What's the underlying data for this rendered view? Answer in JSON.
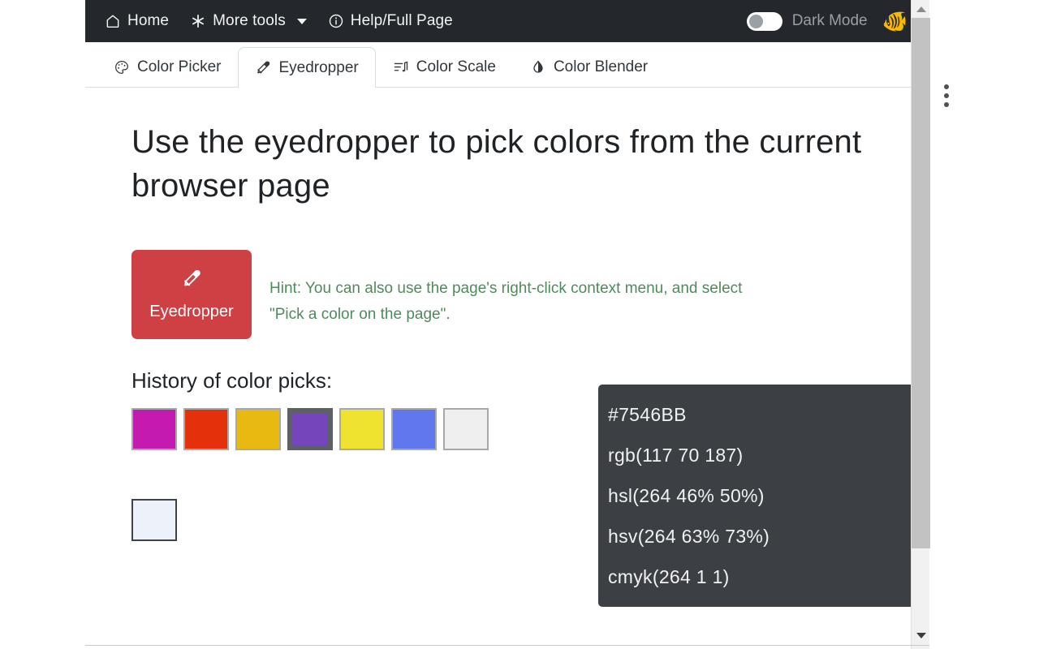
{
  "navbar": {
    "items": [
      {
        "label": "Home",
        "icon": "home-icon"
      },
      {
        "label": "More tools",
        "icon": "asterisk-icon",
        "has_caret": true
      },
      {
        "label": "Help/Full Page",
        "icon": "info-circle-icon"
      }
    ],
    "dark_mode": {
      "label": "Dark Mode",
      "enabled": false
    },
    "brand_emoji": "🐠"
  },
  "tabs": [
    {
      "label": "Color Picker",
      "icon": "palette-icon",
      "active": false
    },
    {
      "label": "Eyedropper",
      "icon": "eyedropper-icon",
      "active": true
    },
    {
      "label": "Color Scale",
      "icon": "scale-list-icon",
      "active": false
    },
    {
      "label": "Color Blender",
      "icon": "droplet-icon",
      "active": false
    }
  ],
  "main": {
    "title": "Use the eyedropper to pick colors from the current browser page",
    "eyedropper_button": {
      "label": "Eyedropper",
      "icon": "eyedropper-icon",
      "color": "#CF4044"
    },
    "hint": "Hint: You can also use the page's right-click context menu, and select \"Pick a color on the page\".",
    "hint_color": "#4F8A5C",
    "history_title": "History of color picks:",
    "history_swatches": [
      {
        "color": "#C51AB0",
        "selected": false
      },
      {
        "color": "#E4300B",
        "selected": false
      },
      {
        "color": "#E8B910",
        "selected": false
      },
      {
        "color": "#7546BB",
        "selected": true
      },
      {
        "color": "#EFE330",
        "selected": false
      },
      {
        "color": "#6077EE",
        "selected": false
      },
      {
        "color": "#EFEFEF",
        "selected": false
      }
    ],
    "current_swatch": {
      "color": "#EDF2FA"
    }
  },
  "values_panel": {
    "background": "#3C4044",
    "rows": [
      {
        "value": "#7546BB",
        "copy_icon": "clipboard-plus-icon"
      },
      {
        "value": "rgb(117 70 187)",
        "copy_icon": "clipboard-plus-icon"
      },
      {
        "value": "hsl(264 46% 50%)",
        "copy_icon": "clipboard-plus-icon"
      },
      {
        "value": "hsv(264 63% 73%)",
        "copy_icon": "clipboard-plus-icon"
      },
      {
        "value": "cmyk(264 1 1)",
        "copy_icon": "clipboard-plus-icon"
      }
    ]
  },
  "scrollbar": {
    "up_arrow": "scroll-up-arrow",
    "down_arrow": "scroll-down-arrow"
  },
  "kebab_menu": {
    "icon": "vertical-dots-icon"
  }
}
